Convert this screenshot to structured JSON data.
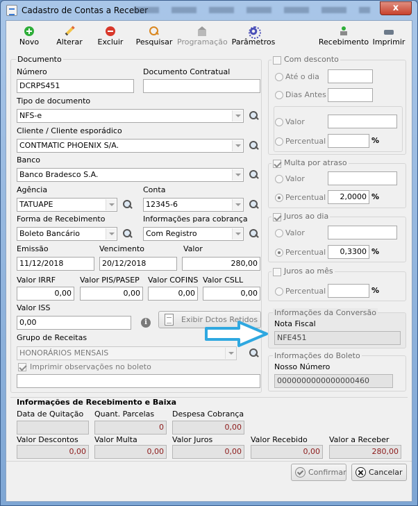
{
  "window": {
    "title": "Cadastro de Contas a Receber",
    "close_glyph": "x"
  },
  "toolbar": {
    "novo": "Novo",
    "alterar": "Alterar",
    "excluir": "Excluir",
    "pesquisar": "Pesquisar",
    "programacao": "Programação",
    "parametros": "Parâmetros",
    "recebimento": "Recebimento",
    "imprimir": "Imprimir"
  },
  "documento": {
    "group_title": "Documento",
    "numero_label": "Número",
    "numero_value": "DCRPS451",
    "contratual_label": "Documento Contratual",
    "contratual_value": "",
    "tipo_label": "Tipo de documento",
    "tipo_value": "NFS-e",
    "cliente_label": "Cliente / Cliente esporádico",
    "cliente_value": "CONTMATIC PHOENIX S/A.",
    "banco_label": "Banco",
    "banco_value": "Banco Bradesco S.A.",
    "agencia_label": "Agência",
    "agencia_value": "TATUAPE",
    "conta_label": "Conta",
    "conta_value": "12345-6",
    "forma_label": "Forma de Recebimento",
    "forma_value": "Boleto Bancário",
    "info_cobranca_label": "Informações para cobrança",
    "info_cobranca_value": "Com Registro",
    "emissao_label": "Emissão",
    "emissao_value": "11/12/2018",
    "vencimento_label": "Vencimento",
    "vencimento_value": "20/12/2018",
    "valor_label": "Valor",
    "valor_value": "280,00",
    "irrf_label": "Valor IRRF",
    "irrf_value": "0,00",
    "pis_label": "Valor PIS/PASEP",
    "pis_value": "0,00",
    "cofins_label": "Valor COFINS",
    "cofins_value": "0,00",
    "csll_label": "Valor CSLL",
    "csll_value": "0,00",
    "iss_label": "Valor ISS",
    "iss_value": "0,00",
    "exibir_button": "Exibir Dctos Retidos",
    "grupo_label": "Grupo de Receitas",
    "grupo_value": "HONORÁRIOS MENSAIS",
    "imprimir_obs_label": "Imprimir observações no boleto",
    "observacoes_value": ""
  },
  "desconto": {
    "title": "Com desconto",
    "ate_o_dia": "Até o dia",
    "dias_antes": "Dias Antes",
    "valor": "Valor",
    "percentual": "Percentual",
    "pct_symbol": "%"
  },
  "multa": {
    "title": "Multa por atraso",
    "valor": "Valor",
    "percentual": "Percentual",
    "percentual_value": "2,0000",
    "pct_symbol": "%"
  },
  "juros_dia": {
    "title": "Juros ao dia",
    "valor": "Valor",
    "percentual": "Percentual",
    "percentual_value": "0,3300",
    "pct_symbol": "%"
  },
  "juros_mes": {
    "title": "Juros ao mês",
    "percentual": "Percentual",
    "pct_symbol": "%"
  },
  "conversao": {
    "title": "Informações da Conversão",
    "nota_label": "Nota Fiscal",
    "nota_value": "NFE451"
  },
  "boleto": {
    "title": "Informações do Boleto",
    "nosso_label": "Nosso Número",
    "nosso_value": "0000000000000000460"
  },
  "recebimento": {
    "title": "Informações de Recebimento e Baixa",
    "quitacao_label": "Data de Quitação",
    "quitacao_value": "",
    "parcelas_label": "Quant. Parcelas",
    "parcelas_value": "0",
    "despesa_label": "Despesa Cobrança",
    "despesa_value": "0,00",
    "descontos_label": "Valor Descontos",
    "descontos_value": "0,00",
    "multa_label": "Valor Multa",
    "multa_value": "0,00",
    "juros_label": "Valor Juros",
    "juros_value": "0,00",
    "recebido_label": "Valor Recebido",
    "recebido_value": "0,00",
    "a_receber_label": "Valor a Receber",
    "a_receber_value": "280,00"
  },
  "footer": {
    "confirmar": "Confirmar",
    "cancelar": "Cancelar"
  },
  "colors": {
    "callout_arrow": "#2fa8e0",
    "title_bar": "#a9c6e8"
  }
}
